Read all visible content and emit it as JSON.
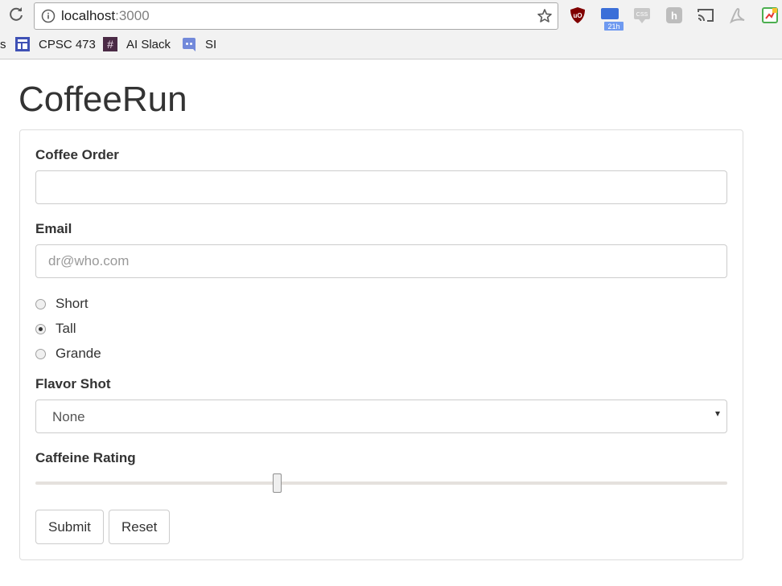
{
  "browser": {
    "url_host": "localhost",
    "url_port": ":3000",
    "extension_badge": "21h",
    "bookmarks": [
      {
        "label": "CPSC 473",
        "icon": "layout-icon"
      },
      {
        "label": "AI Slack",
        "icon": "slack-hash-icon"
      },
      {
        "label": "SI",
        "icon": "discord-icon"
      }
    ]
  },
  "page": {
    "title": "CoffeeRun",
    "form": {
      "coffee_order_label": "Coffee Order",
      "coffee_order_value": "",
      "email_label": "Email",
      "email_placeholder": "dr@who.com",
      "sizes": [
        {
          "label": "Short",
          "checked": false
        },
        {
          "label": "Tall",
          "checked": true
        },
        {
          "label": "Grande",
          "checked": false
        }
      ],
      "flavor_label": "Flavor Shot",
      "flavor_selected": "None",
      "caffeine_label": "Caffeine Rating",
      "caffeine_fraction": 0.35,
      "submit_label": "Submit",
      "reset_label": "Reset"
    }
  },
  "colors": {
    "text": "#333333",
    "border": "#cccccc",
    "panel_border": "#dddddd",
    "chrome_bg": "#f2f2f2"
  }
}
